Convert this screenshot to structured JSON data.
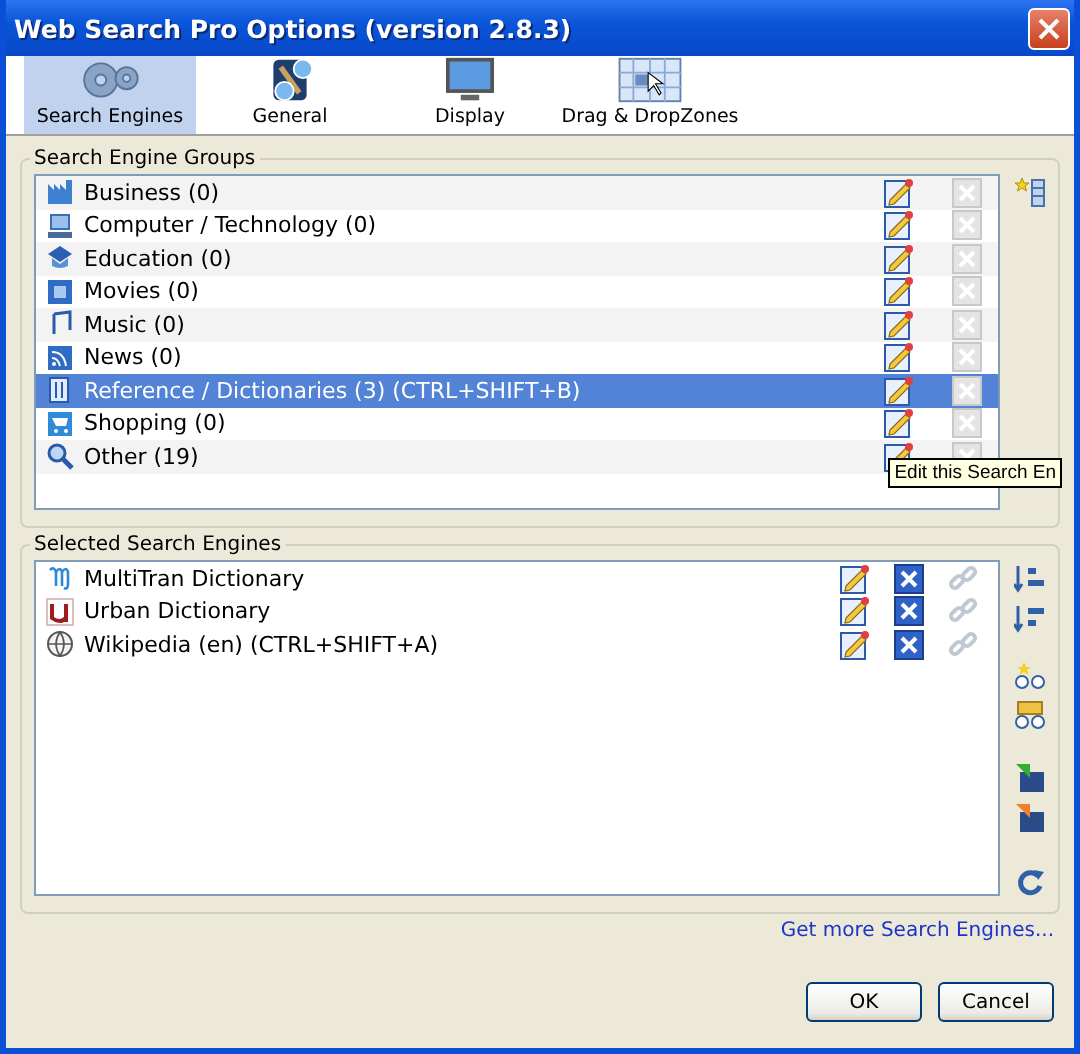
{
  "window": {
    "title": "Web Search Pro Options (version 2.8.3)"
  },
  "tabs": [
    {
      "label": "Search Engines",
      "kind": "gears",
      "selected": true
    },
    {
      "label": "General",
      "kind": "general",
      "selected": false
    },
    {
      "label": "Display",
      "kind": "monitor",
      "selected": false
    },
    {
      "label": "Drag & DropZones",
      "kind": "grid",
      "selected": false
    }
  ],
  "groups": {
    "title": "Search Engine Groups",
    "items": [
      {
        "label": "Business (0)",
        "kind": "business",
        "selected": false,
        "delete_disabled": true
      },
      {
        "label": "Computer / Technology (0)",
        "kind": "computer",
        "selected": false,
        "delete_disabled": true
      },
      {
        "label": "Education (0)",
        "kind": "education",
        "selected": false,
        "delete_disabled": true
      },
      {
        "label": "Movies (0)",
        "kind": "movies",
        "selected": false,
        "delete_disabled": true
      },
      {
        "label": "Music (0)",
        "kind": "music",
        "selected": false,
        "delete_disabled": true
      },
      {
        "label": "News (0)",
        "kind": "news",
        "selected": false,
        "delete_disabled": true
      },
      {
        "label": "Reference / Dictionaries (3) (CTRL+SHIFT+B)",
        "kind": "reference",
        "selected": true,
        "delete_disabled": true
      },
      {
        "label": "Shopping (0)",
        "kind": "shopping",
        "selected": false,
        "delete_disabled": true
      },
      {
        "label": "Other (19)",
        "kind": "other",
        "selected": false,
        "delete_disabled": true
      }
    ],
    "tooltip": "Edit this Search En"
  },
  "engines": {
    "title": "Selected Search Engines",
    "items": [
      {
        "label": "MultiTran Dictionary",
        "kind": "multitran",
        "delete_disabled": false,
        "link_disabled": true
      },
      {
        "label": "Urban Dictionary",
        "kind": "urban",
        "delete_disabled": false,
        "link_disabled": true
      },
      {
        "label": "Wikipedia (en)   (CTRL+SHIFT+A)",
        "kind": "wikipedia",
        "delete_disabled": false,
        "link_disabled": true
      }
    ]
  },
  "link": "Get more Search Engines...",
  "buttons": [
    "OK",
    "Cancel"
  ]
}
